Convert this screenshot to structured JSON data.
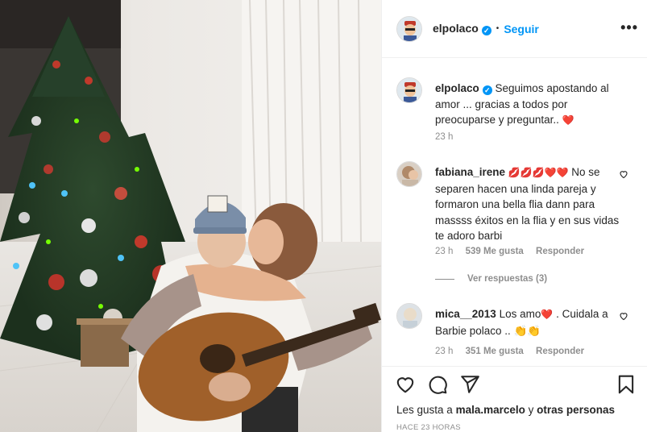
{
  "post": {
    "username": "elpolaco",
    "verified_mark": "✓",
    "dot": "•",
    "follow_label": "Seguir",
    "more_label": "•••"
  },
  "caption": {
    "username": "elpolaco",
    "text": "Seguimos apostando al amor ... gracias a todos por preocuparse y preguntar..",
    "emoji": "❤️",
    "time": "23 h"
  },
  "comments": [
    {
      "username": "fabiana_irene",
      "emoji_prefix": "💋💋💋❤️❤️",
      "text": "No se separen hacen una linda pareja y formaron una bella flia dann para massss éxitos en la flia y en sus vidas te adoro barbi",
      "time": "23 h",
      "likes": "539 Me gusta",
      "reply_label": "Responder",
      "view_replies": "Ver respuestas (3)"
    },
    {
      "username": "mica__2013",
      "text": "Los amo",
      "emoji_mid": "❤️",
      "text2": ". Cuidala a Barbie polaco ..",
      "emoji_end": "👏👏",
      "time": "23 h",
      "likes": "351 Me gusta",
      "reply_label": "Responder"
    }
  ],
  "footer": {
    "likes_prefix": "Les gusta a",
    "likes_user": "mala.marcelo",
    "likes_conj": "y",
    "likes_others": "otras personas",
    "timestamp": "HACE 23 HORAS"
  },
  "icons": {
    "like": "heart-icon",
    "comment": "comment-icon",
    "share": "share-icon",
    "save": "bookmark-icon",
    "comment_like": "small-heart-icon"
  },
  "colors": {
    "accent": "#0095f6",
    "muted": "#8e8e8e",
    "text": "#262626"
  }
}
